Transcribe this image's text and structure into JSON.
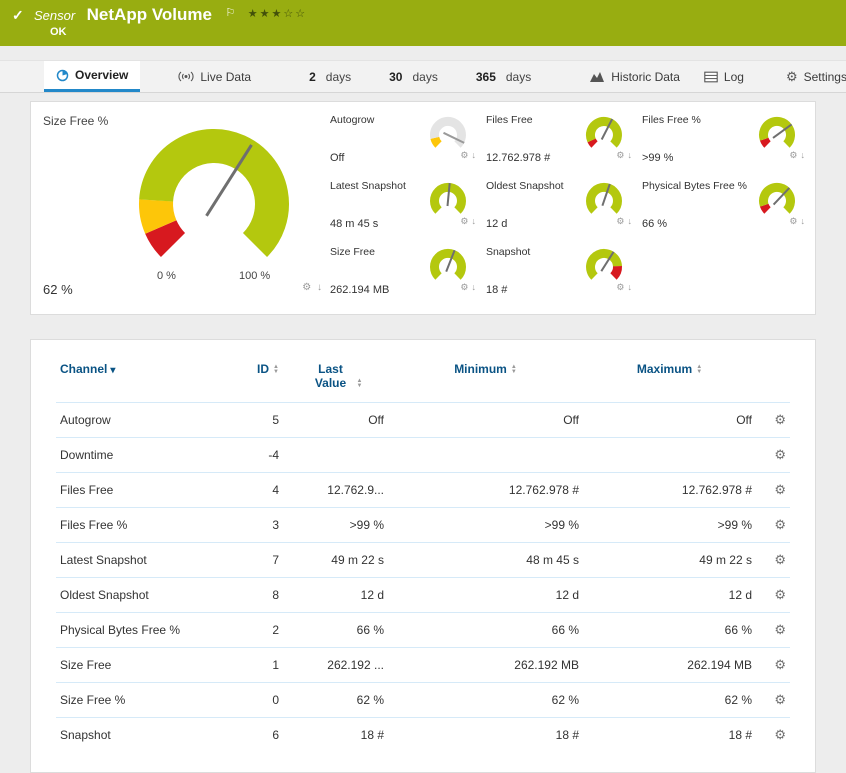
{
  "header": {
    "object_type": "Sensor",
    "title": "NetApp Volume",
    "status": "OK",
    "rating": {
      "filled": 3,
      "total": 5
    }
  },
  "tabs": {
    "overview": "Overview",
    "live_data": "Live Data",
    "d2_num": "2",
    "d2_unit": "days",
    "d30_num": "30",
    "d30_unit": "days",
    "d365_num": "365",
    "d365_unit": "days",
    "historic": "Historic Data",
    "log": "Log",
    "settings": "Settings"
  },
  "icons": {
    "check": "✓",
    "flag": "⚐",
    "star_filled": "★",
    "star_empty": "☆",
    "gear": "⚙",
    "download": "↓",
    "sort_desc": "▾",
    "sort_up": "▲",
    "sort_down": "▼"
  },
  "colors": {
    "header_green": "#98ad11",
    "accent_blue": "#2288c9",
    "gauge_green": "#b4c80e",
    "gauge_yellow": "#fdc609",
    "gauge_red": "#d7191f",
    "table_header_blue": "#0a5384",
    "row_divider": "#d6eaf8"
  },
  "gauges": {
    "main": {
      "label": "Size Free %",
      "value": "62 %",
      "min_label": "0 %",
      "max_label": "100 %",
      "needle_pct": 62,
      "needle_color": "#6f6f6f",
      "segments": [
        {
          "from": 0,
          "to": 8,
          "color": "#d7191f"
        },
        {
          "from": 8,
          "to": 18,
          "color": "#fdc609"
        },
        {
          "from": 18,
          "to": 100,
          "color": "#b4c80e"
        }
      ]
    },
    "small": [
      {
        "label": "Autogrow",
        "value": "Off",
        "needle_pct": 93,
        "needle_color": "#9a9a9a",
        "segments": [
          {
            "from": 0,
            "to": 12,
            "color": "#fdc609"
          },
          {
            "from": 12,
            "to": 100,
            "color": "#e4e4e4"
          }
        ]
      },
      {
        "label": "Files Free",
        "value": "12.762.978 #",
        "needle_pct": 60,
        "needle_color": "#6f6f6f",
        "segments": [
          {
            "from": 0,
            "to": 8,
            "color": "#d7191f"
          },
          {
            "from": 8,
            "to": 100,
            "color": "#b4c80e"
          }
        ]
      },
      {
        "label": "Files Free %",
        "value": ">99 %",
        "needle_pct": 70,
        "needle_color": "#6f6f6f",
        "segments": [
          {
            "from": 0,
            "to": 10,
            "color": "#d7191f"
          },
          {
            "from": 10,
            "to": 100,
            "color": "#b4c80e"
          }
        ]
      },
      {
        "label": "Latest Snapshot",
        "value": "48 m 45 s",
        "needle_pct": 52,
        "needle_color": "#6f6f6f",
        "segments": [
          {
            "from": 0,
            "to": 100,
            "color": "#b4c80e"
          }
        ]
      },
      {
        "label": "Oldest Snapshot",
        "value": "12 d",
        "needle_pct": 57,
        "needle_color": "#6f6f6f",
        "segments": [
          {
            "from": 0,
            "to": 100,
            "color": "#b4c80e"
          }
        ]
      },
      {
        "label": "Physical Bytes Free %",
        "value": "66 %",
        "needle_pct": 66,
        "needle_color": "#6f6f6f",
        "segments": [
          {
            "from": 0,
            "to": 10,
            "color": "#d7191f"
          },
          {
            "from": 10,
            "to": 100,
            "color": "#b4c80e"
          }
        ]
      },
      {
        "label": "Size Free",
        "value": "262.194 MB",
        "needle_pct": 58,
        "needle_color": "#6f6f6f",
        "segments": [
          {
            "from": 0,
            "to": 100,
            "color": "#b4c80e"
          }
        ]
      },
      {
        "label": "Snapshot",
        "value": "18 #",
        "needle_pct": 62,
        "needle_color": "#6f6f6f",
        "segments": [
          {
            "from": 0,
            "to": 82,
            "color": "#b4c80e"
          },
          {
            "from": 82,
            "to": 100,
            "color": "#d7191f"
          }
        ]
      }
    ]
  },
  "table": {
    "columns": [
      "Channel",
      "ID",
      "Last Value",
      "Minimum",
      "Maximum"
    ],
    "rows": [
      {
        "channel": "Autogrow",
        "id": "5",
        "last": "Off",
        "min": "Off",
        "max": "Off"
      },
      {
        "channel": "Downtime",
        "id": "-4",
        "last": "",
        "min": "",
        "max": ""
      },
      {
        "channel": "Files Free",
        "id": "4",
        "last": "12.762.9...",
        "min": "12.762.978 #",
        "max": "12.762.978 #"
      },
      {
        "channel": "Files Free %",
        "id": "3",
        "last": ">99 %",
        "min": ">99 %",
        "max": ">99 %"
      },
      {
        "channel": "Latest Snapshot",
        "id": "7",
        "last": "49 m 22 s",
        "min": "48 m 45 s",
        "max": "49 m 22 s"
      },
      {
        "channel": "Oldest Snapshot",
        "id": "8",
        "last": "12 d",
        "min": "12 d",
        "max": "12 d"
      },
      {
        "channel": "Physical Bytes Free %",
        "id": "2",
        "last": "66 %",
        "min": "66 %",
        "max": "66 %"
      },
      {
        "channel": "Size Free",
        "id": "1",
        "last": "262.192 ...",
        "min": "262.192 MB",
        "max": "262.194 MB"
      },
      {
        "channel": "Size Free %",
        "id": "0",
        "last": "62 %",
        "min": "62 %",
        "max": "62 %"
      },
      {
        "channel": "Snapshot",
        "id": "6",
        "last": "18 #",
        "min": "18 #",
        "max": "18 #"
      }
    ]
  }
}
